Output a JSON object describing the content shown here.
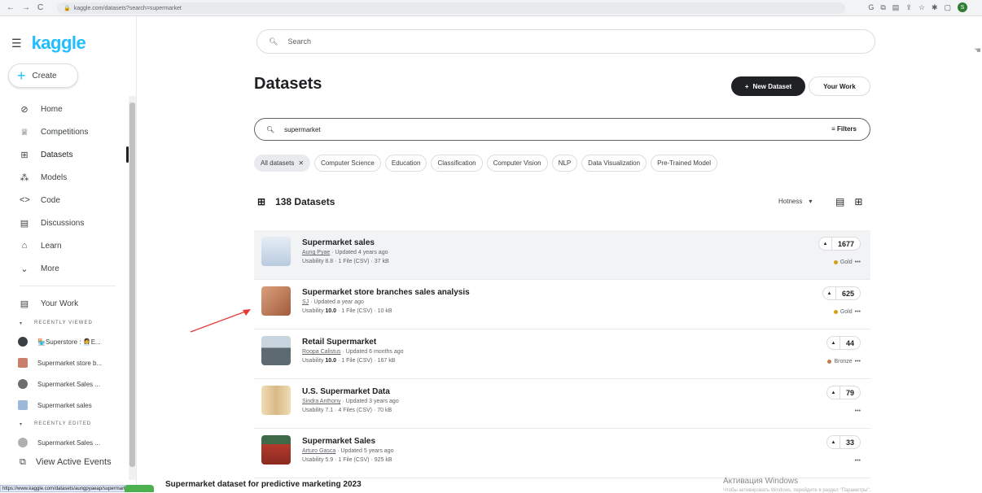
{
  "browser": {
    "nav_icons": [
      "←",
      "→",
      "C"
    ],
    "url": "kaggle.com/datasets?search=supermarket",
    "ext_icons": [
      "G",
      "⧉",
      "▤",
      "⇪",
      "☆",
      "✱",
      "▢"
    ],
    "profile": "S"
  },
  "sidebar": {
    "logo": "kaggle",
    "create_label": "Create",
    "nav_items": [
      {
        "label": "Home",
        "icon": "⊘"
      },
      {
        "label": "Competitions",
        "icon": "♕"
      },
      {
        "label": "Datasets",
        "icon": "⊞"
      },
      {
        "label": "Models",
        "icon": "⁂"
      },
      {
        "label": "Code",
        "icon": "<>"
      },
      {
        "label": "Discussions",
        "icon": "▤"
      },
      {
        "label": "Learn",
        "icon": "⌂"
      },
      {
        "label": "More",
        "icon": "⌄"
      }
    ],
    "your_work": "Your Work",
    "recently_viewed_label": "RECENTLY VIEWED",
    "recently_viewed": [
      {
        "label": "🏪Superstore : 👩‍💼E...",
        "color": "#3c4043"
      },
      {
        "label": "Supermarket store b...",
        "color": "#c97f6b"
      },
      {
        "label": "Supermarket Sales ...",
        "color": "#6d6d6d"
      },
      {
        "label": "Supermarket sales",
        "color": "#9bb8d9"
      }
    ],
    "recently_edited_label": "RECENTLY EDITED",
    "recently_edited": [
      {
        "label": "Supermarket Sales ...",
        "color": "#b0b0b0"
      }
    ],
    "active_events": "View Active Events"
  },
  "status_url": "https://www.kaggle.com/datasets/aungpyaeap/supermarket-sales",
  "main": {
    "search_placeholder": "Search",
    "title": "Datasets",
    "new_dataset": "New Dataset",
    "your_work": "Your Work",
    "query": "supermarket",
    "filters": "Filters",
    "chips": [
      "All datasets",
      "Computer Science",
      "Education",
      "Classification",
      "Computer Vision",
      "NLP",
      "Data Visualization",
      "Pre-Trained Model"
    ],
    "count": "138 Datasets",
    "sort": "Hotness",
    "datasets": [
      {
        "title": "Supermarket sales",
        "author": "Aung Pyae",
        "updated": "Updated 4 years ago",
        "usability": "8.8",
        "files": "1 File (CSV)",
        "size": "37 kB",
        "votes": "1677",
        "medal": "Gold",
        "medal_color": "#d4a017",
        "img_color": "#c9d7e8"
      },
      {
        "title": "Supermarket store branches sales analysis",
        "author": "SJ",
        "updated": "Updated a year ago",
        "usability": "10.0",
        "files": "1 File (CSV)",
        "size": "10 kB",
        "votes": "625",
        "medal": "Gold",
        "medal_color": "#d4a017",
        "img_color": "#c9805e"
      },
      {
        "title": "Retail Supermarket",
        "author": "Roopa Calistus",
        "updated": "Updated 6 months ago",
        "usability": "10.0",
        "files": "1 File (CSV)",
        "size": "167 kB",
        "votes": "44",
        "medal": "Bronze",
        "medal_color": "#c27a4a",
        "img_color": "#7d8a94"
      },
      {
        "title": "U.S. Supermarket Data",
        "author": "Sindra Anthony",
        "updated": "Updated 3 years ago",
        "usability": "7.1",
        "files": "4 Files (CSV)",
        "size": "70 kB",
        "votes": "79",
        "medal": "",
        "medal_color": "",
        "img_color": "#e0c9a0"
      },
      {
        "title": "Supermarket Sales",
        "author": "Arturo Gasca",
        "updated": "Updated 5 years ago",
        "usability": "5.9",
        "files": "1 File (CSV)",
        "size": "925 kB",
        "votes": "33",
        "medal": "",
        "medal_color": "",
        "img_color": "#a83a2c"
      }
    ],
    "partial_title": "Supermarket dataset for predictive marketing 2023"
  },
  "watermark": {
    "line1": "Активация Windows",
    "line2": "Чтобы активировать Windows, перейдите в раздел \"Параметры\"."
  }
}
